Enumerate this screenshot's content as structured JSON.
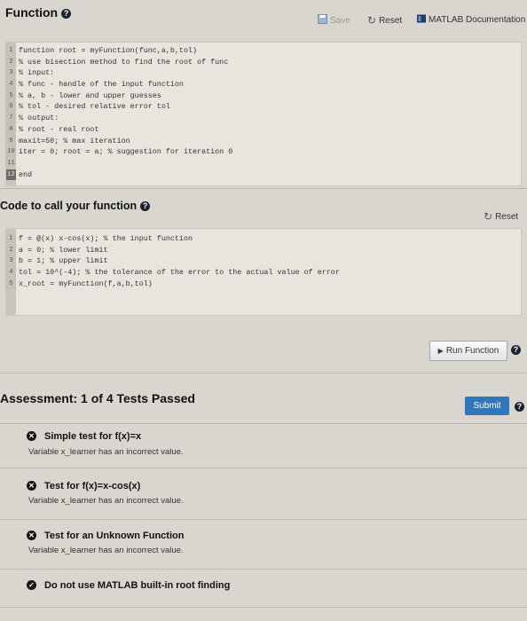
{
  "function_section": {
    "title": "Function",
    "toolbar": {
      "save": "Save",
      "reset": "Reset",
      "docs": "MATLAB Documentation"
    },
    "code": [
      "function root = myFunction(func,a,b,tol)",
      "% use bisection method to find the root of func",
      "% input:",
      "% func - handle of the input function",
      "% a, b - lower and upper guesses",
      "% tol - desired relative error tol",
      "% output:",
      "% root - real root",
      "maxit=50; % max iteration",
      "iter = 0; root = a; % suggestion for iteration 0",
      "",
      "end"
    ]
  },
  "call_section": {
    "title": "Code to call your function",
    "reset": "Reset",
    "code": [
      "f = @(x) x-cos(x); % the input function",
      "a = 0; % lower limit",
      "b = 1; % upper limit",
      "tol = 10^(-4); % the tolerance of the error to the actual value of error",
      "x_root = myFunction(f,a,b,tol)"
    ],
    "run_button": "Run Function"
  },
  "assessment": {
    "title": "Assessment: 1 of 4 Tests Passed",
    "submit": "Submit",
    "tests": [
      {
        "title": "Simple test for f(x)=x",
        "message": "Variable x_learner has an incorrect value.",
        "status": "failed"
      },
      {
        "title": "Test for f(x)=x-cos(x)",
        "message": "Variable x_learner has an incorrect value.",
        "status": "failed"
      },
      {
        "title": "Test for an Unknown Function",
        "message": "Variable x_learner has an incorrect value.",
        "status": "failed"
      },
      {
        "title": "Do not use MATLAB built-in root finding",
        "message": "",
        "status": "passed"
      }
    ]
  }
}
